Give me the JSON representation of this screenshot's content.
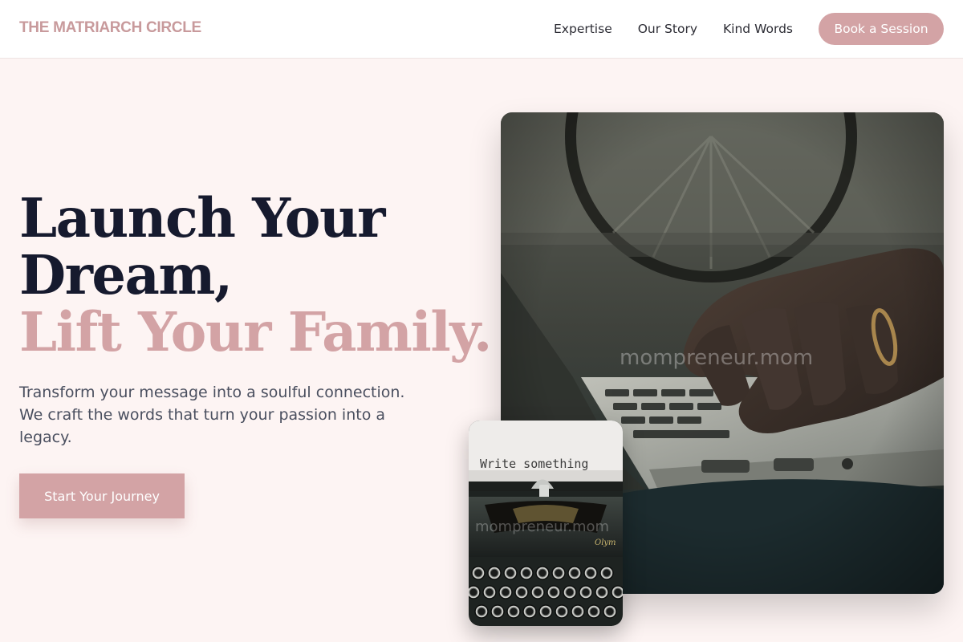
{
  "header": {
    "logo": "THE MATRIARCH CIRCLE",
    "nav": [
      "Expertise",
      "Our Story",
      "Kind Words"
    ],
    "cta": "Book a Session"
  },
  "hero": {
    "title_line1": "Launch Your",
    "title_line2": "Dream,",
    "title_line3": "Lift Your Family.",
    "subtitle": "Transform your message into a soulful connection. We craft the words that turn your passion into a legacy.",
    "button": "Start Your Journey"
  },
  "images": {
    "main_watermark": "mompreneur.mom",
    "small_paper_text": "Write something",
    "small_watermark": "mompreneur.mom",
    "small_brand": "Olym"
  },
  "colors": {
    "accent": "#d3a3a5",
    "heading": "#161a2e",
    "background": "#fdf4f3"
  }
}
